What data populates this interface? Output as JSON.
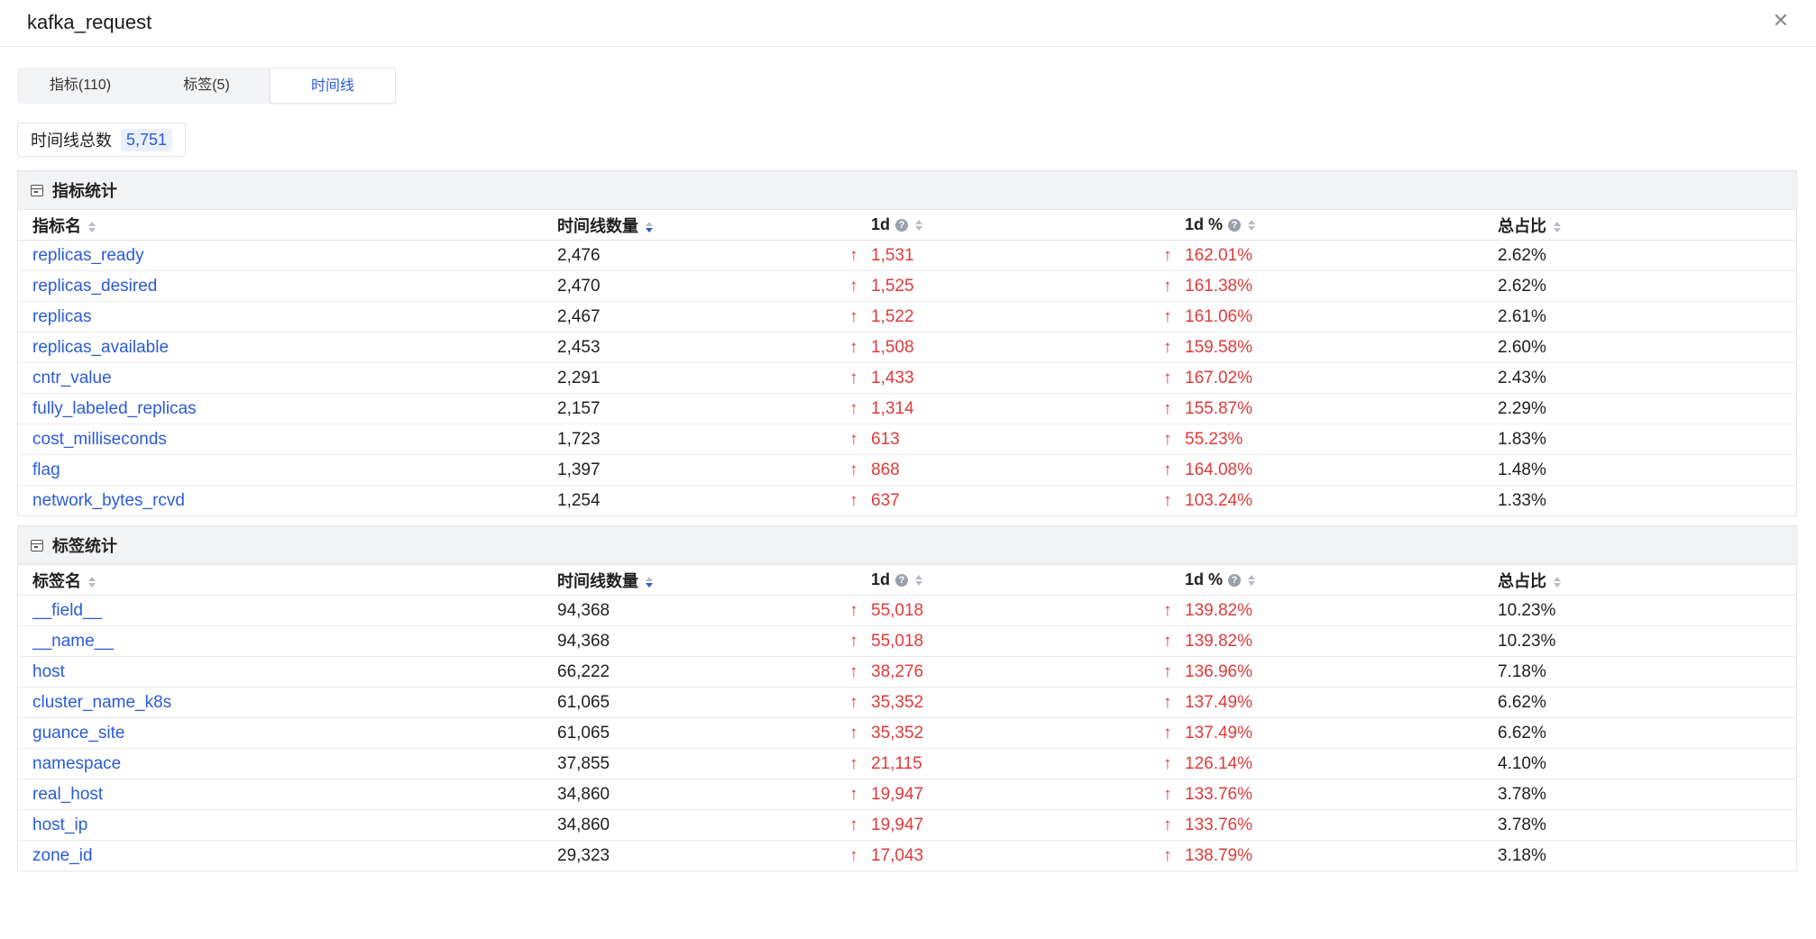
{
  "modal": {
    "title": "kafka_request"
  },
  "tabs": [
    {
      "label": "指标(110)"
    },
    {
      "label": "标签(5)"
    },
    {
      "label": "时间线"
    }
  ],
  "total": {
    "label": "时间线总数",
    "value": "5,751"
  },
  "icons": {
    "close": "close-icon",
    "panel": "table-icon",
    "trend": "arrow-up-icon",
    "help": "question-circle-icon",
    "sort": "sort-icon"
  },
  "colors": {
    "link": "#2b5bd7",
    "increase": "#e03a3a",
    "header_bg": "#f2f3f5"
  },
  "metrics": {
    "title": "指标统计",
    "columns": [
      "指标名",
      "时间线数量",
      "1d",
      "1d %",
      "总占比"
    ],
    "rows": [
      {
        "name": "replicas_ready",
        "count": "2,476",
        "d1": "1,531",
        "d1p": "162.01%",
        "share": "2.62%"
      },
      {
        "name": "replicas_desired",
        "count": "2,470",
        "d1": "1,525",
        "d1p": "161.38%",
        "share": "2.62%"
      },
      {
        "name": "replicas",
        "count": "2,467",
        "d1": "1,522",
        "d1p": "161.06%",
        "share": "2.61%"
      },
      {
        "name": "replicas_available",
        "count": "2,453",
        "d1": "1,508",
        "d1p": "159.58%",
        "share": "2.60%"
      },
      {
        "name": "cntr_value",
        "count": "2,291",
        "d1": "1,433",
        "d1p": "167.02%",
        "share": "2.43%"
      },
      {
        "name": "fully_labeled_replicas",
        "count": "2,157",
        "d1": "1,314",
        "d1p": "155.87%",
        "share": "2.29%"
      },
      {
        "name": "cost_milliseconds",
        "count": "1,723",
        "d1": "613",
        "d1p": "55.23%",
        "share": "1.83%"
      },
      {
        "name": "flag",
        "count": "1,397",
        "d1": "868",
        "d1p": "164.08%",
        "share": "1.48%"
      },
      {
        "name": "network_bytes_rcvd",
        "count": "1,254",
        "d1": "637",
        "d1p": "103.24%",
        "share": "1.33%"
      }
    ]
  },
  "tags": {
    "title": "标签统计",
    "columns": [
      "标签名",
      "时间线数量",
      "1d",
      "1d %",
      "总占比"
    ],
    "rows": [
      {
        "name": "__field__",
        "count": "94,368",
        "d1": "55,018",
        "d1p": "139.82%",
        "share": "10.23%"
      },
      {
        "name": "__name__",
        "count": "94,368",
        "d1": "55,018",
        "d1p": "139.82%",
        "share": "10.23%"
      },
      {
        "name": "host",
        "count": "66,222",
        "d1": "38,276",
        "d1p": "136.96%",
        "share": "7.18%"
      },
      {
        "name": "cluster_name_k8s",
        "count": "61,065",
        "d1": "35,352",
        "d1p": "137.49%",
        "share": "6.62%"
      },
      {
        "name": "guance_site",
        "count": "61,065",
        "d1": "35,352",
        "d1p": "137.49%",
        "share": "6.62%"
      },
      {
        "name": "namespace",
        "count": "37,855",
        "d1": "21,115",
        "d1p": "126.14%",
        "share": "4.10%"
      },
      {
        "name": "real_host",
        "count": "34,860",
        "d1": "19,947",
        "d1p": "133.76%",
        "share": "3.78%"
      },
      {
        "name": "host_ip",
        "count": "34,860",
        "d1": "19,947",
        "d1p": "133.76%",
        "share": "3.78%"
      },
      {
        "name": "zone_id",
        "count": "29,323",
        "d1": "17,043",
        "d1p": "138.79%",
        "share": "3.18%"
      }
    ]
  }
}
